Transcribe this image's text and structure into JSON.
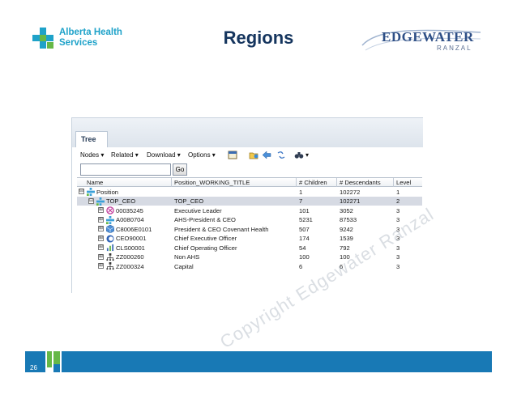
{
  "slide": {
    "title": "Regions",
    "page_number": "26",
    "footer_color": "#1879b5"
  },
  "ahs_logo": {
    "line1": "Alberta Health",
    "line2": "Services",
    "color": "#1ea2c9"
  },
  "edgewater_logo": {
    "word": "EDGEWATER",
    "sub": "RANZAL",
    "color": "#2e4f86"
  },
  "panel": {
    "tab_label": "Tree",
    "toolbar": {
      "nodes": "Nodes ▾",
      "related": "Related ▾",
      "download": "Download ▾",
      "options": "Options ▾",
      "binoculars_dropdown": "▾"
    },
    "search": {
      "value": "",
      "go_label": "Go"
    },
    "columns": [
      "Name",
      "Position_WORKING_TITLE",
      "# Children",
      "# Descendants",
      "Level"
    ],
    "rows": [
      {
        "name": "Position",
        "title": "",
        "children": "1",
        "descendants": "102272",
        "level": "1",
        "expander": "⊟",
        "icon": "hierarchy-icon"
      },
      {
        "name": "TOP_CEO",
        "title": "TOP_CEO",
        "children": "7",
        "descendants": "102271",
        "level": "2",
        "expander": "⊟",
        "icon": "hierarchy-icon",
        "selected": true
      },
      {
        "name": "00035245",
        "title": "Executive Leader",
        "children": "101",
        "descendants": "3052",
        "level": "3",
        "expander": "⊞",
        "icon": "org-pink-icon"
      },
      {
        "name": "A0080704",
        "title": "AHS-President & CEO",
        "children": "5231",
        "descendants": "87533",
        "level": "3",
        "expander": "⊞",
        "icon": "hierarchy-icon"
      },
      {
        "name": "C8006E0101",
        "title": "President & CEO Covenant Health",
        "children": "507",
        "descendants": "9242",
        "level": "3",
        "expander": "⊞",
        "icon": "cube-icon"
      },
      {
        "name": "CEO90001",
        "title": "Chief Executive Officer",
        "children": "174",
        "descendants": "1539",
        "level": "3",
        "expander": "⊞",
        "icon": "ce-icon"
      },
      {
        "name": "CLS00001",
        "title": "Chief Operating Officer",
        "children": "54",
        "descendants": "792",
        "level": "3",
        "expander": "⊞",
        "icon": "chart-icon"
      },
      {
        "name": "ZZ000260",
        "title": "Non AHS",
        "children": "100",
        "descendants": "100",
        "level": "3",
        "expander": "⊞",
        "icon": "tree-small-icon"
      },
      {
        "name": "ZZ000324",
        "title": "Capital",
        "children": "6",
        "descendants": "6",
        "level": "3",
        "expander": "⊞",
        "icon": "tree-small-icon"
      }
    ]
  },
  "watermark": "Copyright Edgewater Ranzal"
}
